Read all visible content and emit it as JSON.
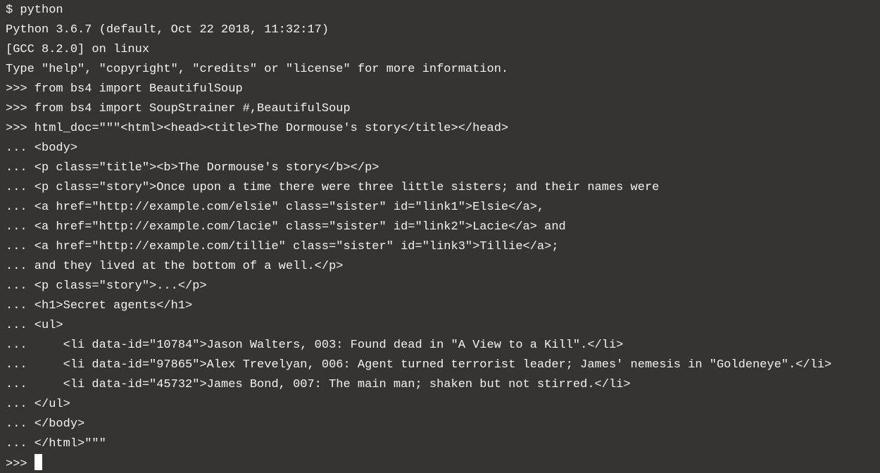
{
  "terminal": {
    "lines": [
      "$ python",
      "Python 3.6.7 (default, Oct 22 2018, 11:32:17)",
      "[GCC 8.2.0] on linux",
      "Type \"help\", \"copyright\", \"credits\" or \"license\" for more information.",
      ">>> from bs4 import BeautifulSoup",
      ">>> from bs4 import SoupStrainer #,BeautifulSoup",
      ">>> html_doc=\"\"\"<html><head><title>The Dormouse's story</title></head>",
      "... <body>",
      "... <p class=\"title\"><b>The Dormouse's story</b></p>",
      "... <p class=\"story\">Once upon a time there were three little sisters; and their names were",
      "... <a href=\"http://example.com/elsie\" class=\"sister\" id=\"link1\">Elsie</a>,",
      "... <a href=\"http://example.com/lacie\" class=\"sister\" id=\"link2\">Lacie</a> and",
      "... <a href=\"http://example.com/tillie\" class=\"sister\" id=\"link3\">Tillie</a>;",
      "... and they lived at the bottom of a well.</p>",
      "... <p class=\"story\">...</p>",
      "... <h1>Secret agents</h1>",
      "... <ul>",
      "...     <li data-id=\"10784\">Jason Walters, 003: Found dead in \"A View to a Kill\".</li>",
      "...     <li data-id=\"97865\">Alex Trevelyan, 006: Agent turned terrorist leader; James' nemesis in \"Goldeneye\".</li>",
      "...     <li data-id=\"45732\">James Bond, 007: The main man; shaken but not stirred.</li>",
      "... </ul>",
      "... </body>",
      "... </html>\"\"\""
    ],
    "prompt": ">>> ",
    "colors": {
      "background": "#353430",
      "text": "#f2f2ee",
      "cursor": "#ffffff"
    }
  }
}
